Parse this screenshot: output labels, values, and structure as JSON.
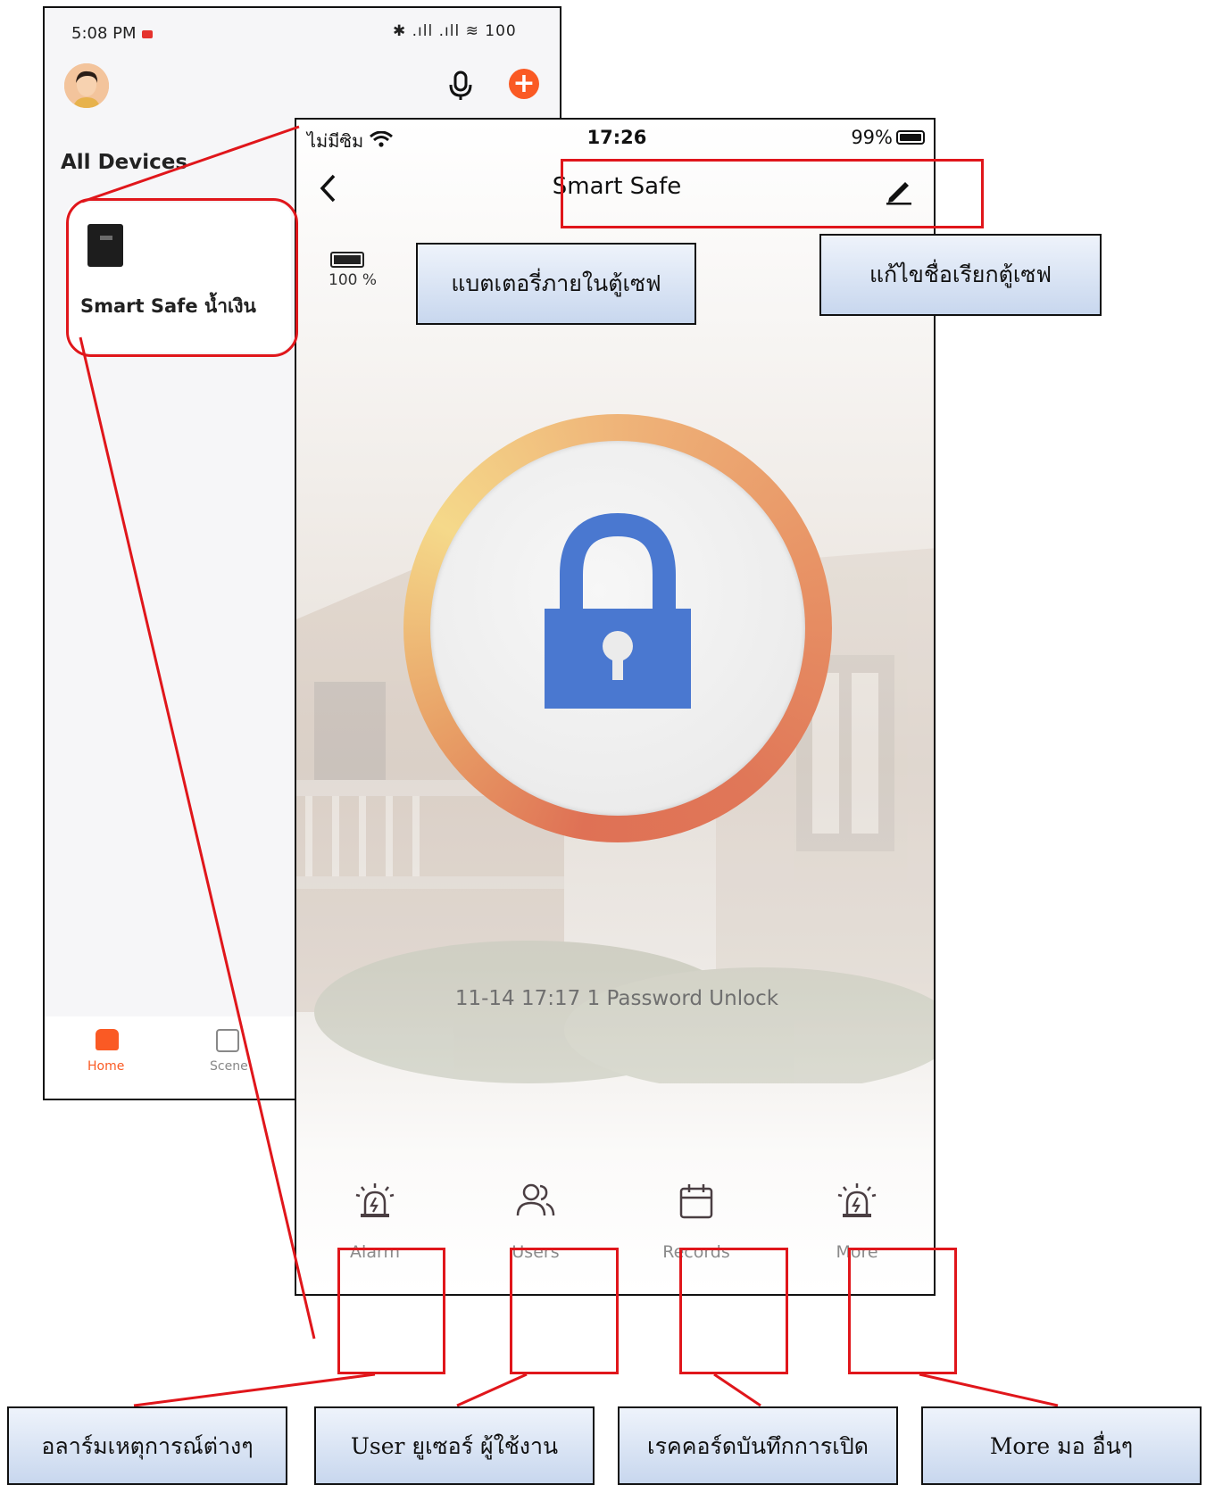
{
  "home_screen": {
    "status_time": "5:08 PM",
    "status_icons": "✱ .ıll .ıll ≋ 100",
    "section_title": "All Devices",
    "device_name": "Smart Safe น้ำเงิน",
    "nav": {
      "home": "Home",
      "scene": "Scene"
    }
  },
  "safe_screen": {
    "status": {
      "carrier": "ไม่มีซิม",
      "time": "17:26",
      "battery": "99%"
    },
    "title": "Smart Safe",
    "device_battery": "100 %",
    "last_record": "11-14 17:17  1 Password Unlock",
    "tabs": [
      {
        "label": "Alarm",
        "icon": "siren-icon"
      },
      {
        "label": "Users",
        "icon": "users-icon"
      },
      {
        "label": "Records",
        "icon": "calendar-icon"
      },
      {
        "label": "More",
        "icon": "siren-icon"
      }
    ]
  },
  "callouts": {
    "battery": "แบตเตอรี่ภายในตู้เซฟ",
    "rename": "แก้ไขชื่อเรียกตู้เซฟ",
    "alarm": "อลาร์มเหตุการณ์ต่างๆ",
    "users": "User ยูเซอร์ ผู้ใช้งาน",
    "records": "เรคคอร์ดบันทึกการเปิด",
    "more": "More มอ อื่นๆ"
  },
  "colors": {
    "accent": "#fa5a24",
    "lock_blue": "#4a78d0",
    "highlight": "#e0161b"
  }
}
